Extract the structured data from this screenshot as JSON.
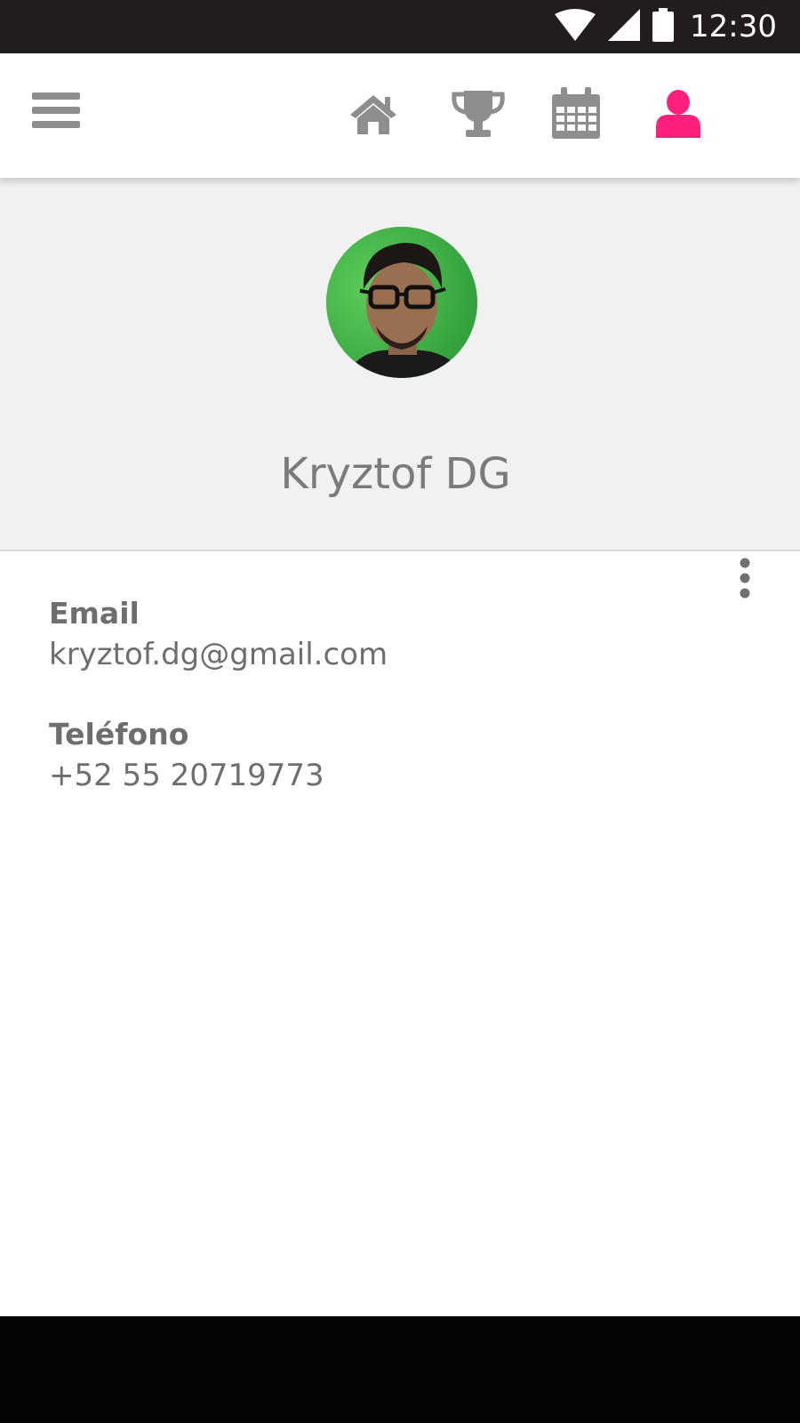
{
  "status_bar": {
    "time": "12:30",
    "icons": [
      "wifi-icon",
      "cell-signal-icon",
      "battery-icon"
    ]
  },
  "app_bar": {
    "menu_icon": "hamburger-menu-icon",
    "nav_items": [
      {
        "icon": "home-icon",
        "active": false
      },
      {
        "icon": "trophy-icon",
        "active": false
      },
      {
        "icon": "calendar-icon",
        "active": false
      },
      {
        "icon": "profile-icon",
        "active": true
      }
    ]
  },
  "profile": {
    "name": "Kryztof DG"
  },
  "details": {
    "email_label": "Email",
    "email_value": "kryztof.dg@gmail.com",
    "phone_label": "Teléfono",
    "phone_value": "+52 55 20719773",
    "more_icon": "more-vert-icon"
  },
  "colors": {
    "accent": "#ff1f7c",
    "icon_gray": "#8e8e8e",
    "status_bar": "#231c1e",
    "header_bg": "#f1f1f1"
  }
}
